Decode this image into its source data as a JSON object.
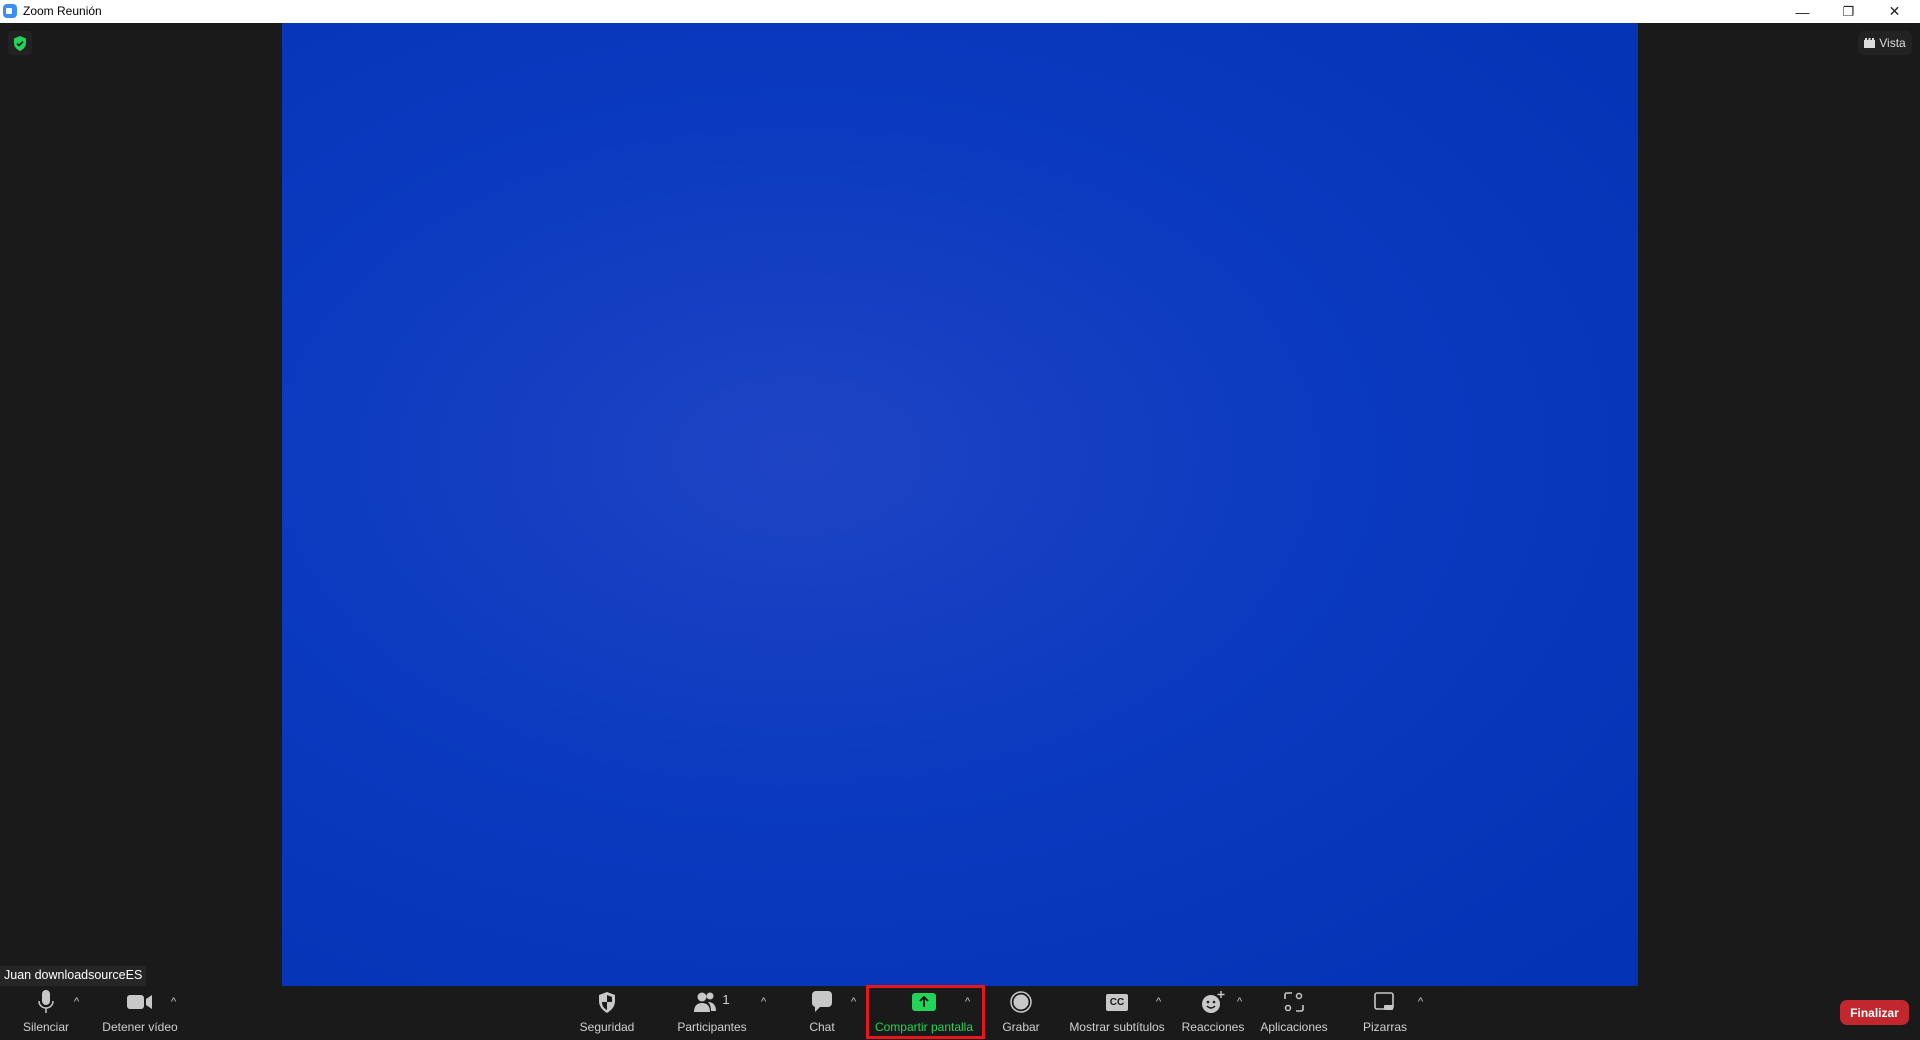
{
  "window": {
    "title": "Zoom Reunión",
    "minimize": "—",
    "restore": "❐",
    "close": "✕"
  },
  "view_button": {
    "label": "Vista",
    "icon": "view-grid-icon"
  },
  "participant_name": "Juan downloadsourceES",
  "colors": {
    "video_bg": "#0b3ac0",
    "share_green": "#22d45a",
    "end_red": "#c1272d",
    "highlight": "#e5161e",
    "encryption_green": "#22d45a"
  },
  "toolbar": {
    "mute": {
      "label": "Silenciar",
      "icon": "microphone-icon"
    },
    "video": {
      "label": "Detener vídeo",
      "icon": "video-camera-icon"
    },
    "security": {
      "label": "Seguridad",
      "icon": "shield-icon"
    },
    "participants": {
      "label": "Participantes",
      "count": "1",
      "icon": "participants-icon"
    },
    "chat": {
      "label": "Chat",
      "icon": "chat-icon"
    },
    "share": {
      "label": "Compartir pantalla",
      "icon": "share-screen-icon"
    },
    "record": {
      "label": "Grabar",
      "icon": "record-icon"
    },
    "captions": {
      "label": "Mostrar subtítulos",
      "icon_text": "CC"
    },
    "reactions": {
      "label": "Reacciones",
      "icon": "reactions-icon"
    },
    "apps": {
      "label": "Aplicaciones",
      "icon": "apps-icon"
    },
    "whiteboards": {
      "label": "Pizarras",
      "icon": "whiteboard-icon"
    },
    "caret": "^",
    "end": {
      "label": "Finalizar"
    }
  }
}
